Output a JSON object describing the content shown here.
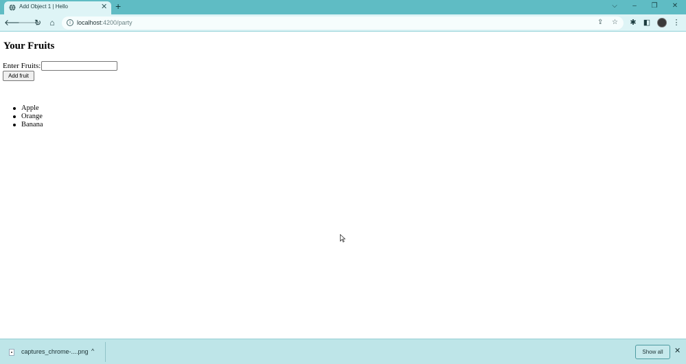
{
  "browser": {
    "tab": {
      "title": "Add Object 1 | Hello",
      "close": "✕"
    },
    "new_tab": "+",
    "window": {
      "tab_search": "⌵",
      "minimize": "–",
      "restore": "❐",
      "close": "✕"
    },
    "url": {
      "host": "localhost",
      "path": ":4200/party"
    },
    "icons": {
      "back": "🡐",
      "forward": "🡒",
      "reload": "↻",
      "home": "⌂",
      "info": "i",
      "share": "⇪",
      "star": "☆",
      "extensions": "✱",
      "sidebar": "◧",
      "menu": "⋮"
    }
  },
  "page": {
    "title": "Your Fruits",
    "input_label": "Enter Fruits:",
    "input_value": "",
    "add_button": "Add fruit",
    "fruits": [
      "Apple",
      "Orange",
      "Banana"
    ]
  },
  "download_bar": {
    "file_name": "captures_chrome-....png",
    "chevron": "^",
    "show_all": "Show all",
    "close": "✕"
  }
}
